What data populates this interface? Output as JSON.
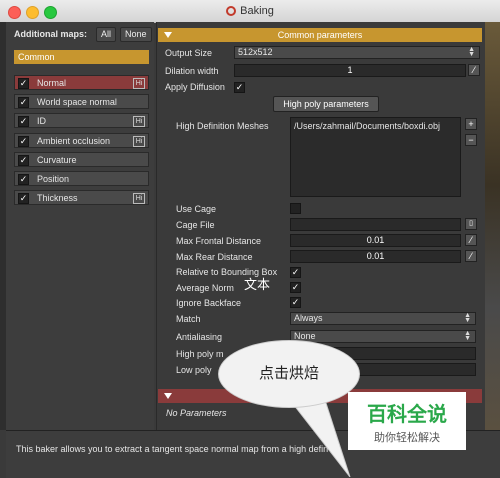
{
  "window": {
    "title": "Baking"
  },
  "left": {
    "additional_maps_label": "Additional maps:",
    "all_label": "All",
    "none_label": "None",
    "common_label": "Common",
    "maps": [
      {
        "label": "Normal",
        "checked": "✓",
        "hi": "Hi"
      },
      {
        "label": "World space normal",
        "checked": "✓",
        "hi": ""
      },
      {
        "label": "ID",
        "checked": "✓",
        "hi": "Hi"
      },
      {
        "label": "Ambient occlusion",
        "checked": "✓",
        "hi": "Hi"
      },
      {
        "label": "Curvature",
        "checked": "✓",
        "hi": ""
      },
      {
        "label": "Position",
        "checked": "✓",
        "hi": ""
      },
      {
        "label": "Thickness",
        "checked": "✓",
        "hi": "Hi"
      }
    ]
  },
  "common": {
    "header": "Common parameters",
    "output_size_label": "Output Size",
    "output_size_value": "512x512",
    "dilation_label": "Dilation width",
    "dilation_value": "1",
    "apply_diffusion_label": "Apply Diffusion"
  },
  "highpoly": {
    "button": "High poly parameters",
    "meshes_label": "High Definition Meshes",
    "mesh_path": "/Users/zahmail/Documents/boxdi.obj",
    "use_cage_label": "Use Cage",
    "cage_file_label": "Cage File",
    "max_frontal_label": "Max Frontal Distance",
    "max_frontal_value": "0.01",
    "max_rear_label": "Max Rear Distance",
    "max_rear_value": "0.01",
    "relative_bbox_label": "Relative to Bounding Box",
    "average_normals_label": "Average Norm",
    "ignore_backface_label": "Ignore Backface",
    "match_label": "Match",
    "match_value": "Always",
    "antialiasing_label": "Antialiasing",
    "antialiasing_value": "None",
    "high_poly_label": "High poly m",
    "low_poly_label": "Low poly"
  },
  "second_section": {
    "no_params": "No Parameters"
  },
  "bottom": {
    "description": "This baker allows you to extract a tangent space normal map from a high defin"
  },
  "overlay": {
    "bubble_text": "点击烘焙",
    "text_annotation": "文本",
    "watermark_main": "百科全说",
    "watermark_sub": "助你轻松解决"
  }
}
